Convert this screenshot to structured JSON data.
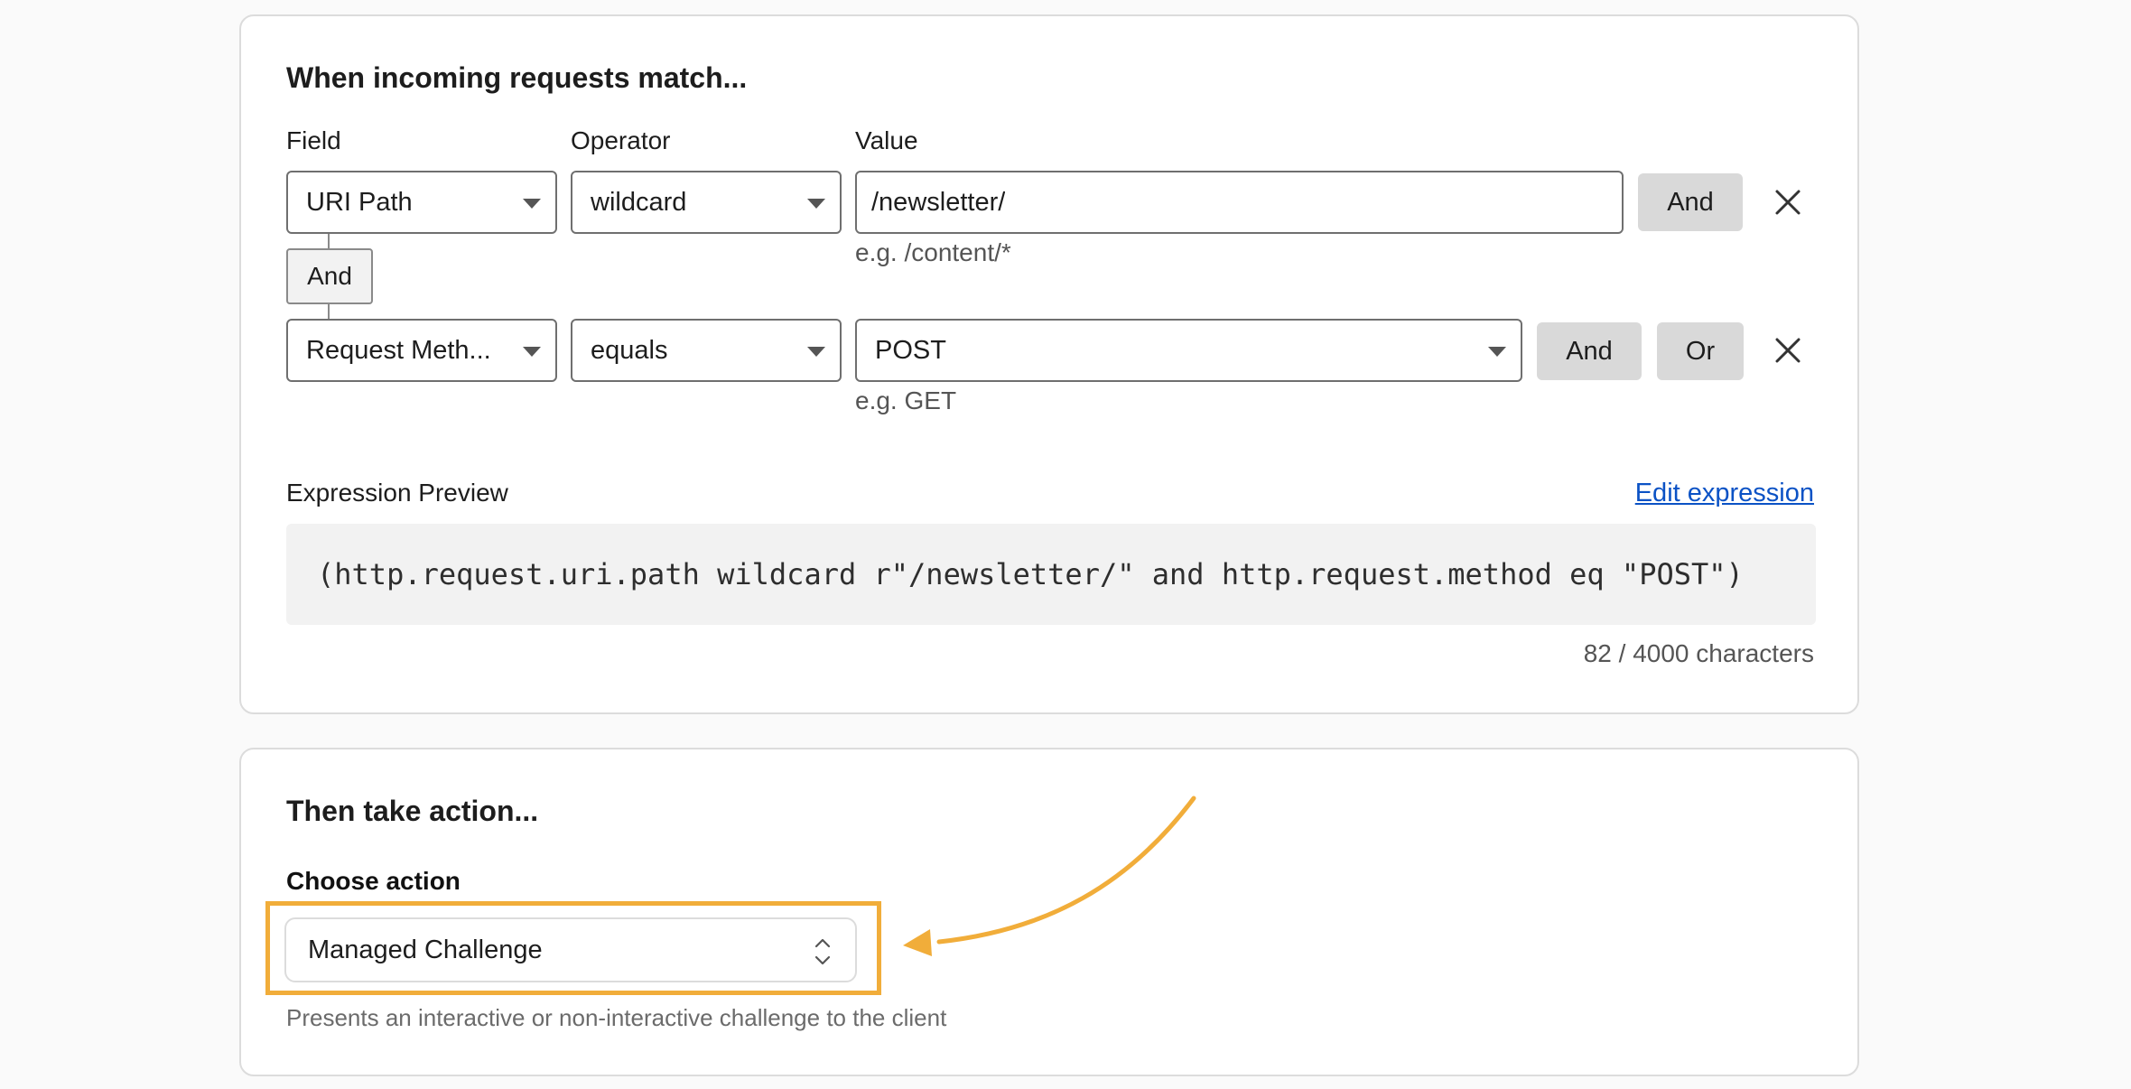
{
  "match_section": {
    "title": "When incoming requests match...",
    "columns": {
      "field": "Field",
      "operator": "Operator",
      "value": "Value"
    },
    "rows": [
      {
        "field": "URI Path",
        "operator": "wildcard",
        "value": "/newsletter/",
        "hint": "e.g. /content/*",
        "and_label": "And"
      },
      {
        "field": "Request Meth...",
        "operator": "equals",
        "value": "POST",
        "hint": "e.g. GET",
        "and_label": "And",
        "or_label": "Or"
      }
    ],
    "connector_label": "And",
    "expression_preview_label": "Expression Preview",
    "edit_expression_label": "Edit expression",
    "expression": "(http.request.uri.path wildcard r\"/newsletter/\" and http.request.method eq \"POST\")",
    "character_count": "82 / 4000 characters"
  },
  "action_section": {
    "title": "Then take action...",
    "choose_action_label": "Choose action",
    "selected_action": "Managed Challenge",
    "description": "Presents an interactive or non-interactive challenge to the client"
  },
  "colors": {
    "highlight": "#f1ad3a",
    "link": "#0b52c5",
    "button_bg": "#d9d9d9"
  },
  "icons": {
    "remove": "close-icon",
    "dropdown": "caret-down-icon",
    "action_dropdown": "chevron-up-down-icon",
    "annotation": "curved-arrow-icon"
  }
}
